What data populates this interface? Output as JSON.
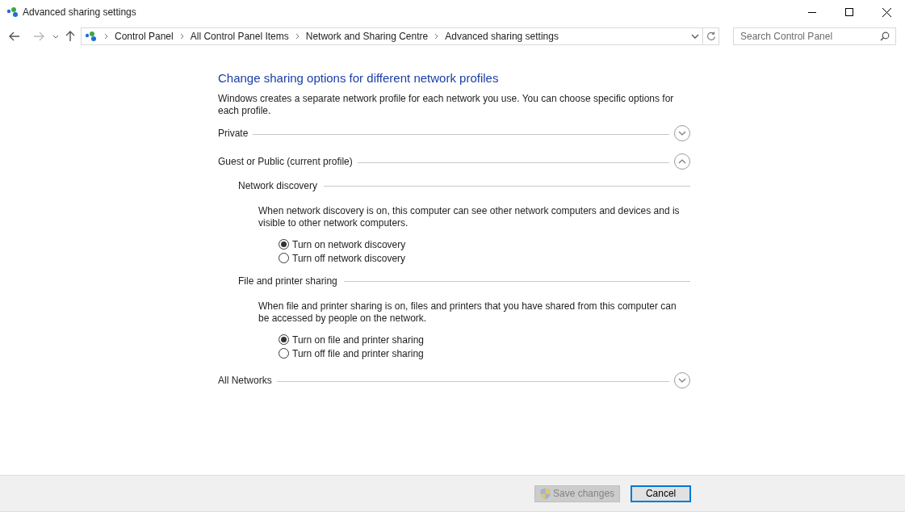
{
  "window": {
    "title": "Advanced sharing settings"
  },
  "breadcrumb": [
    "Control Panel",
    "All Control Panel Items",
    "Network and Sharing Centre",
    "Advanced sharing settings"
  ],
  "search": {
    "placeholder": "Search Control Panel"
  },
  "heading": "Change sharing options for different network profiles",
  "intro": "Windows creates a separate network profile for each network you use. You can choose specific options for each profile.",
  "profiles": [
    {
      "label": "Private",
      "expanded": false
    },
    {
      "label": "Guest or Public (current profile)",
      "expanded": true,
      "sections": [
        {
          "title": "Network discovery",
          "description": "When network discovery is on, this computer can see other network computers and devices and is visible to other network computers.",
          "options": [
            {
              "label": "Turn on network discovery",
              "selected": true
            },
            {
              "label": "Turn off network discovery",
              "selected": false
            }
          ]
        },
        {
          "title": "File and printer sharing",
          "description": "When file and printer sharing is on, files and printers that you have shared from this computer can be accessed by people on the network.",
          "options": [
            {
              "label": "Turn on file and printer sharing",
              "selected": true
            },
            {
              "label": "Turn off file and printer sharing",
              "selected": false
            }
          ]
        }
      ]
    },
    {
      "label": "All Networks",
      "expanded": false
    }
  ],
  "buttons": [
    {
      "label": "Save changes",
      "kind": "shield",
      "disabled": true,
      "focused": false
    },
    {
      "label": "Cancel",
      "kind": "plain",
      "disabled": false,
      "focused": true
    }
  ]
}
